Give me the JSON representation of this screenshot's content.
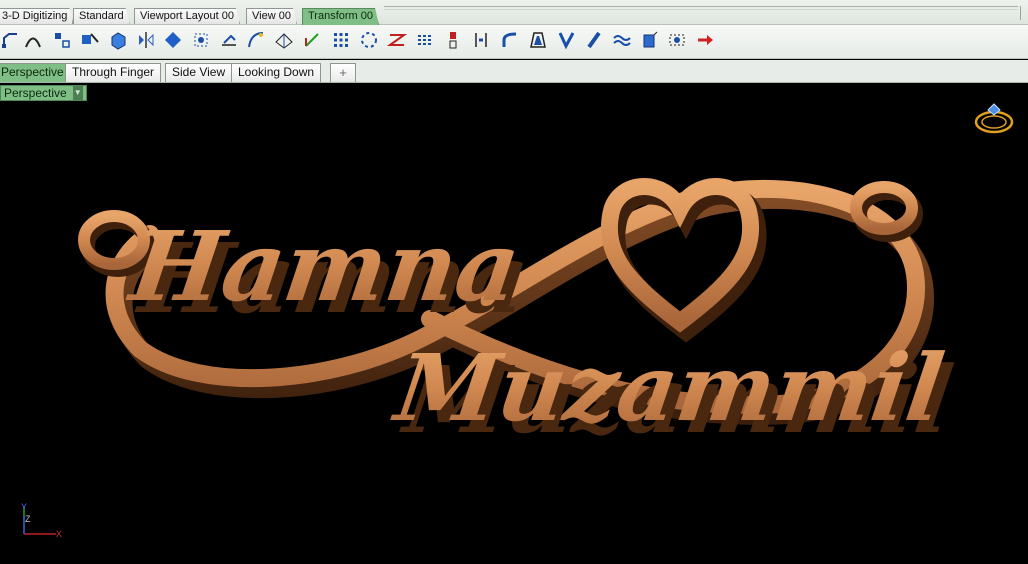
{
  "toolbar_tabs": [
    {
      "label": "3-D Digitizing",
      "active": false
    },
    {
      "label": "Standard",
      "active": false
    },
    {
      "label": "Viewport Layout 00",
      "active": false
    },
    {
      "label": "View 00",
      "active": false
    },
    {
      "label": "Transform 00",
      "active": true
    }
  ],
  "tools": [
    "curve-icon",
    "arc-icon",
    "transform-icon",
    "move-icon",
    "cube-icon",
    "mirror-icon",
    "diamond-icon",
    "gumball-icon",
    "scale-icon",
    "bend-icon",
    "plane-icon",
    "axis-icon",
    "array-icon",
    "polar-array-icon",
    "twist-icon",
    "path-array-icon",
    "align-icon",
    "flow-icon",
    "taper-icon",
    "cage-icon",
    "smash-icon",
    "stretch-icon",
    "wave-icon",
    "box-edit-icon",
    "morph-icon",
    "arrow-right-icon"
  ],
  "viewport_tabs": [
    {
      "label": "Perspective",
      "active": true
    },
    {
      "label": "Through Finger",
      "active": false
    },
    {
      "label": "Side View",
      "active": false
    },
    {
      "label": "Looking Down",
      "active": false
    }
  ],
  "add_tab_label": "+",
  "viewport": {
    "label": "Perspective",
    "model_text_top": "Hamna",
    "model_text_bottom": "Muzammil",
    "axis_labels": {
      "y": "Y",
      "z": "Z",
      "x": "X"
    },
    "colors": {
      "model": "#d08850",
      "model_shadow": "#5a3418",
      "background": "#000000"
    }
  }
}
